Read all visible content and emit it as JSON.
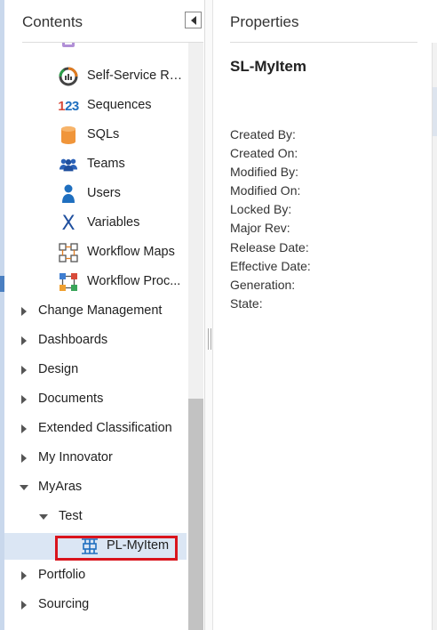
{
  "contents": {
    "title": "Contents",
    "tree": [
      {
        "kind": "child",
        "icon": "self-service-report-icon",
        "label": "Self-Service Re..."
      },
      {
        "kind": "child",
        "icon": "sequences-icon",
        "icon_text": "123",
        "label": "Sequences"
      },
      {
        "kind": "child",
        "icon": "sqls-icon",
        "label": "SQLs"
      },
      {
        "kind": "child",
        "icon": "teams-icon",
        "label": "Teams"
      },
      {
        "kind": "child",
        "icon": "users-icon",
        "label": "Users"
      },
      {
        "kind": "child",
        "icon": "variables-icon",
        "icon_text": "X",
        "label": "Variables"
      },
      {
        "kind": "child",
        "icon": "workflow-maps-icon",
        "label": "Workflow Maps"
      },
      {
        "kind": "child",
        "icon": "workflow-process-icon",
        "label": "Workflow Proc..."
      },
      {
        "kind": "top",
        "label": "Change Management",
        "expanded": false
      },
      {
        "kind": "top",
        "label": "Dashboards",
        "expanded": false
      },
      {
        "kind": "top",
        "label": "Design",
        "expanded": false
      },
      {
        "kind": "top",
        "label": "Documents",
        "expanded": false
      },
      {
        "kind": "top",
        "label": "Extended Classification",
        "expanded": false
      },
      {
        "kind": "top",
        "label": "My Innovator",
        "expanded": false
      },
      {
        "kind": "top",
        "label": "MyAras",
        "expanded": true
      },
      {
        "kind": "sub",
        "label": "Test",
        "expanded": true
      },
      {
        "kind": "child",
        "icon": "pl-item-icon",
        "label": "PL-MyItem",
        "selected": true
      },
      {
        "kind": "top",
        "label": "Portfolio",
        "expanded": false
      },
      {
        "kind": "top",
        "label": "Sourcing",
        "expanded": false
      }
    ]
  },
  "properties": {
    "title": "Properties",
    "item_name": "SL-MyItem",
    "fields": [
      "Created By:",
      "Created On:",
      "Modified By:",
      "Modified On:",
      "Locked By:",
      "Major Rev:",
      "Release Date:",
      "Effective Date:",
      "Generation:",
      "State:"
    ]
  },
  "colors": {
    "selection_bg": "#dbe6f4",
    "highlight_border": "#d9141d",
    "accent_blue": "#1f6fbf"
  }
}
